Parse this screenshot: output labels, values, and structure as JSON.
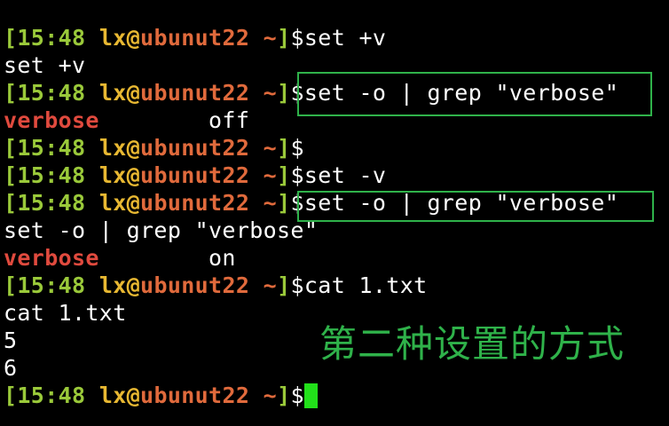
{
  "prompt": {
    "time": "15:48",
    "user": "lx",
    "host": "ubunut22",
    "path": "~",
    "symbol": "$"
  },
  "lines": [
    {
      "kind": "prompt",
      "cmd": "set +v"
    },
    {
      "kind": "output",
      "text": "set +v"
    },
    {
      "kind": "prompt",
      "cmd": "set -o | grep \"verbose\"",
      "highlighted": true
    },
    {
      "kind": "setting",
      "name": "verbose",
      "gap": "        ",
      "value": "off"
    },
    {
      "kind": "prompt",
      "cmd": ""
    },
    {
      "kind": "prompt",
      "cmd": "set -v"
    },
    {
      "kind": "prompt",
      "cmd": "set -o | grep \"verbose\"",
      "highlighted": true
    },
    {
      "kind": "output",
      "text": "set -o | grep \"verbose\""
    },
    {
      "kind": "setting",
      "name": "verbose",
      "gap": "        ",
      "value": "on"
    },
    {
      "kind": "prompt",
      "cmd": "cat 1.txt"
    },
    {
      "kind": "output",
      "text": "cat 1.txt"
    },
    {
      "kind": "output",
      "text": "5"
    },
    {
      "kind": "output",
      "text": "6"
    },
    {
      "kind": "prompt",
      "cmd": "",
      "cursor": true
    }
  ],
  "annotation": "第二种设置的方式",
  "colors": {
    "background": "#000000",
    "prompt_bracket": "#9ac93a",
    "user": "#e8b832",
    "host": "#e06a3c",
    "setting_name": "#e04a3e",
    "highlight_box": "#2fb24a",
    "cursor": "#22e01a"
  }
}
